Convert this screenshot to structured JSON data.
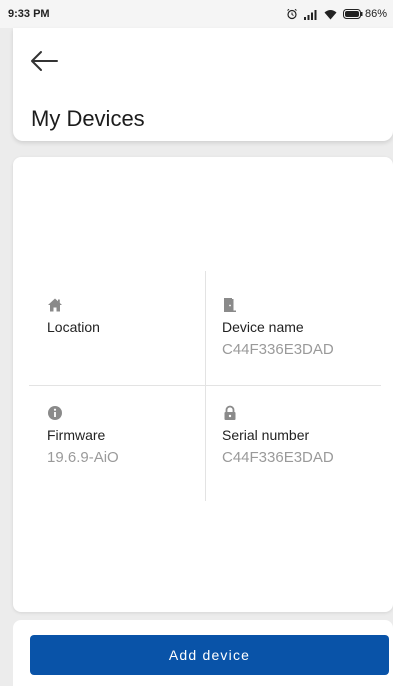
{
  "status_bar": {
    "time": "9:33 PM",
    "battery": "86%",
    "icons": [
      "alarm-icon",
      "signal-icon",
      "wifi-icon",
      "battery-icon"
    ]
  },
  "header": {
    "back_icon": "arrow-left-icon",
    "title": "My Devices"
  },
  "device_info": {
    "location": {
      "icon": "home-icon",
      "label": "Location",
      "value": ""
    },
    "device_name": {
      "icon": "door-icon",
      "label": "Device name",
      "value": "C44F336E3DAD"
    },
    "firmware": {
      "icon": "info-icon",
      "label": "Firmware",
      "value": "19.6.9-AiO"
    },
    "serial_number": {
      "icon": "lock-icon",
      "label": "Serial number",
      "value": "C44F336E3DAD"
    }
  },
  "actions": {
    "add_device_label": "Add device"
  },
  "colors": {
    "primary": "#0953a8",
    "background": "#ececec",
    "card": "#ffffff",
    "value_text": "#9a9a9a"
  }
}
